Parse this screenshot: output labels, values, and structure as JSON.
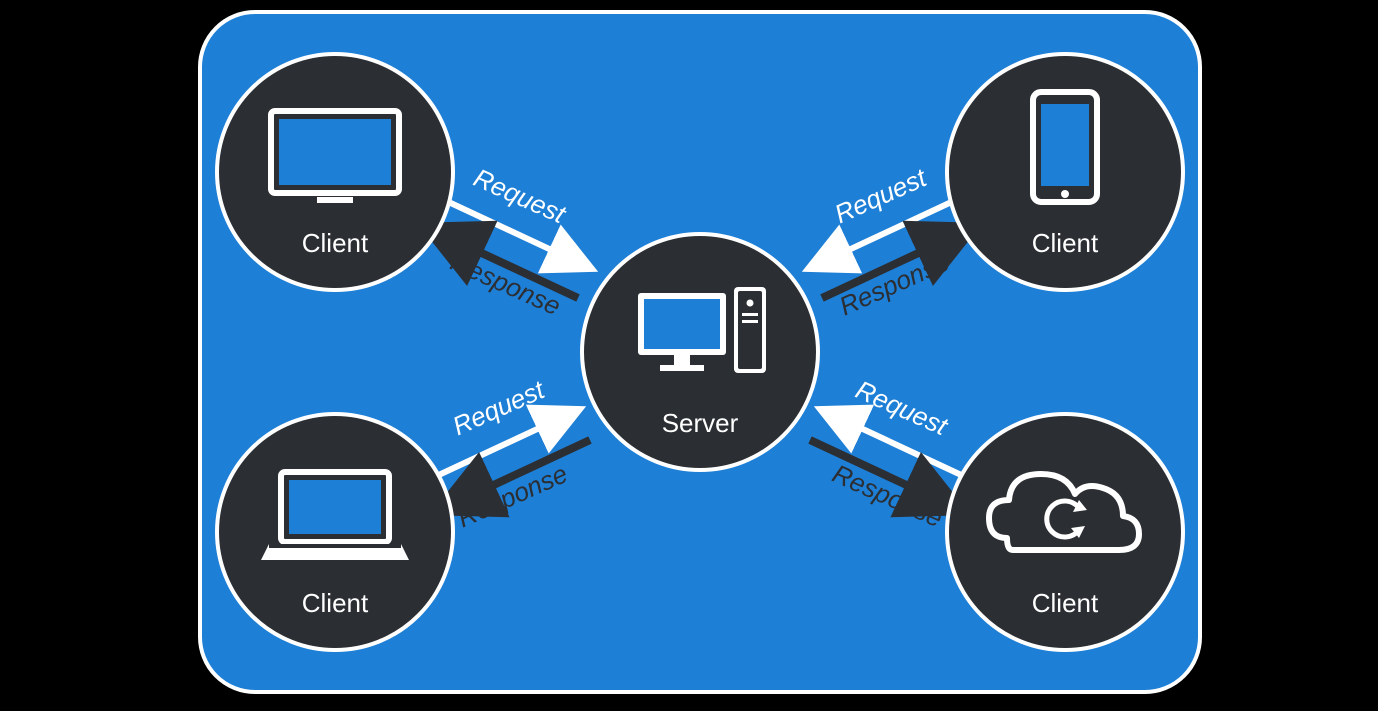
{
  "colors": {
    "panel_bg": "#1e7fd6",
    "panel_stroke": "#ffffff",
    "node_bg": "#2b2e33",
    "node_stroke": "#ffffff",
    "label_text": "#ffffff",
    "request_arrow": "#ffffff",
    "response_arrow": "#2b2e33"
  },
  "nodes": {
    "server": {
      "label": "Server"
    },
    "client_tv": {
      "label": "Client"
    },
    "client_phone": {
      "label": "Client"
    },
    "client_laptop": {
      "label": "Client"
    },
    "client_cloud": {
      "label": "Client"
    }
  },
  "edges": {
    "tv": {
      "request_label": "Request",
      "response_label": "Response"
    },
    "phone": {
      "request_label": "Request",
      "response_label": "Response"
    },
    "laptop": {
      "request_label": "Request",
      "response_label": "Response"
    },
    "cloud": {
      "request_label": "Request",
      "response_label": "Response"
    }
  }
}
